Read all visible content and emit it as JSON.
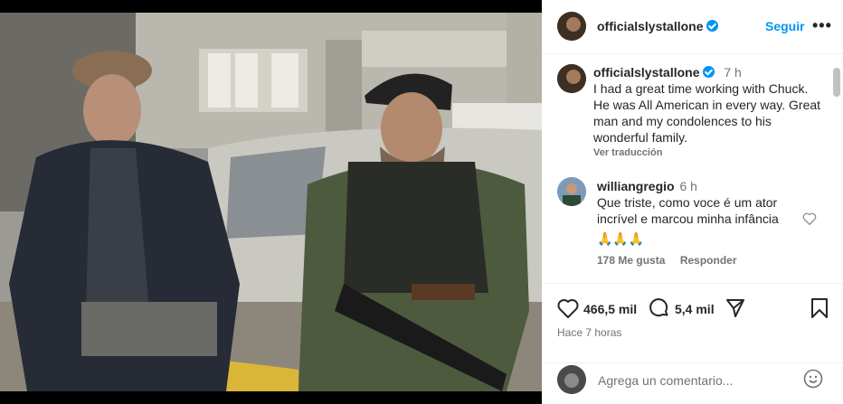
{
  "post": {
    "username": "officialslystallone",
    "follow_label": "Seguir",
    "more_label": "•••"
  },
  "caption": {
    "username": "officialslystallone",
    "time": "7 h",
    "lines": [
      "I had a great time working with Chuck.",
      "He was All American in every way. Great",
      "man and my condolences to his",
      "wonderful family."
    ],
    "translate_label": "Ver traducción"
  },
  "comment": {
    "username": "williangregio",
    "time": "6 h",
    "lines": [
      "Que triste, como voce é um ator",
      "incrível e marcou minha infância",
      "🙏🙏🙏"
    ],
    "likes": "178 Me gusta",
    "reply_label": "Responder"
  },
  "stats": {
    "likes": "466,5 mil",
    "comments": "5,4 mil",
    "posted": "Hace 7 horas"
  },
  "add_comment": {
    "placeholder": "Agrega un comentario..."
  },
  "colors": {
    "accent": "#0095f6",
    "text": "#262626",
    "muted": "#737373"
  }
}
